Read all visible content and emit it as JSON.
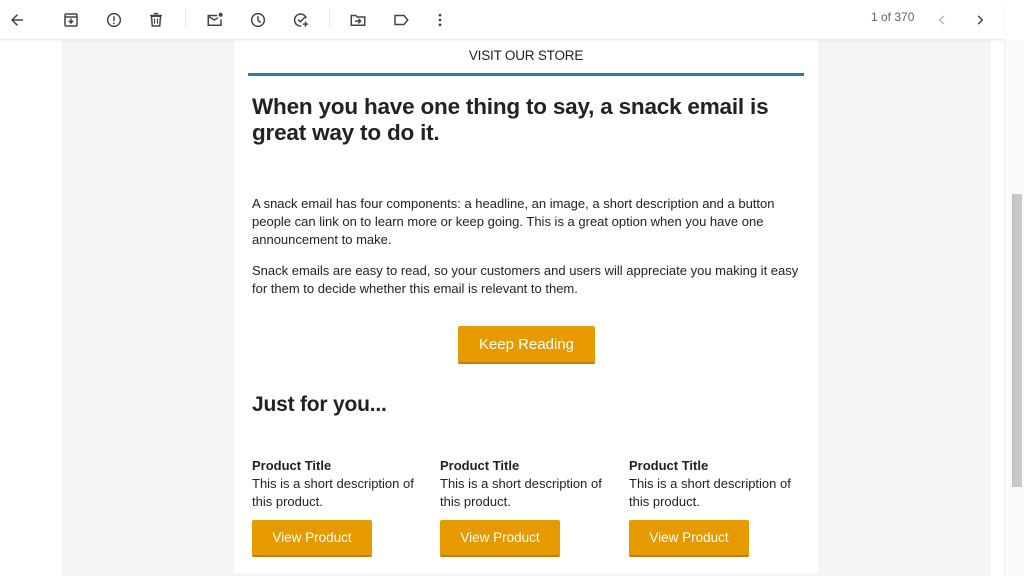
{
  "toolbar": {
    "buttons": [
      {
        "name": "back",
        "icon": "arrow-left-icon"
      },
      {
        "name": "archive",
        "icon": "archive-icon"
      },
      {
        "name": "report-spam",
        "icon": "report-icon"
      },
      {
        "name": "delete",
        "icon": "trash-icon"
      },
      {
        "name": "mark-unread",
        "icon": "mark-unread-icon"
      },
      {
        "name": "snooze",
        "icon": "clock-icon"
      },
      {
        "name": "add-to-tasks",
        "icon": "add-task-icon"
      },
      {
        "name": "move-to",
        "icon": "move-folder-icon"
      },
      {
        "name": "labels",
        "icon": "label-icon"
      },
      {
        "name": "more",
        "icon": "more-vert-icon"
      }
    ],
    "pager": "1 of 370"
  },
  "email": {
    "store_link": "VISIT OUR STORE",
    "accent_color": "#3375b9",
    "headline": "When you have one thing to say, a snack email is great way to do it.",
    "paragraphs": [
      "A snack email has four components: a headline, an image, a short description and a button people can link on to learn more or keep going. This is a great option when you have one announcement to make.",
      "Snack emails are easy to read, so your customers and users will appreciate you making it easy for them to decide whether this email is relevant to them."
    ],
    "cta_label": "Keep Reading",
    "button_color": "#e79a00",
    "section_title": "Just for you...",
    "products": [
      {
        "title": "Product Title",
        "description": "This is a short description of this product.",
        "button": "View Product"
      },
      {
        "title": "Product Title",
        "description": "This is a short description of this product.",
        "button": "View Product"
      },
      {
        "title": "Product Title",
        "description": "This is a short description of this product.",
        "button": "View Product"
      }
    ]
  }
}
